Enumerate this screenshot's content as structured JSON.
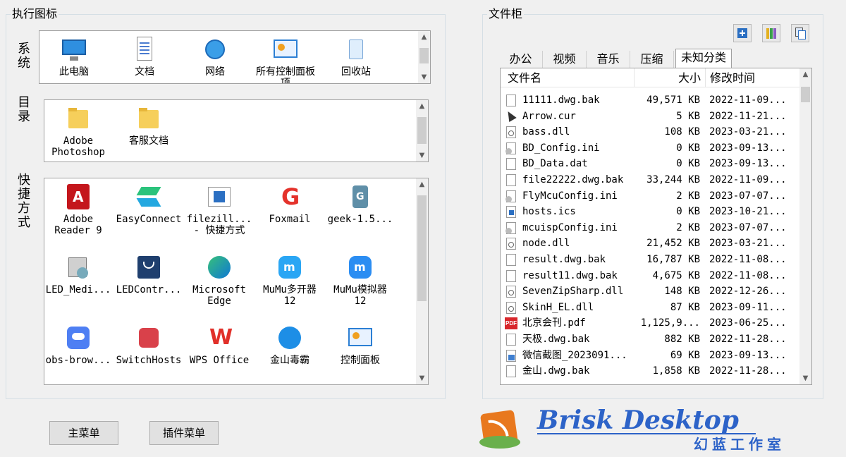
{
  "left_group": {
    "title": "执行图标"
  },
  "sections": {
    "system": {
      "label": "系统"
    },
    "directory": {
      "label": "目录"
    },
    "shortcut": {
      "label": "快捷方式"
    }
  },
  "system_items": [
    {
      "label": "此电脑",
      "icon": "computer-icon"
    },
    {
      "label": "文档",
      "icon": "document-icon"
    },
    {
      "label": "网络",
      "icon": "network-icon"
    },
    {
      "label": "所有控制面板项",
      "icon": "control-panel-icon"
    },
    {
      "label": "回收站",
      "icon": "recycle-bin-icon"
    }
  ],
  "directory_items": [
    {
      "label": "Adobe\nPhotoshop",
      "icon": "folder-icon"
    },
    {
      "label": "客服文档",
      "icon": "folder-icon"
    }
  ],
  "shortcut_items": [
    {
      "label": "Adobe\nReader 9",
      "icon": "adobe-reader-icon"
    },
    {
      "label": "EasyConnect",
      "icon": "easyconnect-icon"
    },
    {
      "label": "filezill...\n- 快捷方式",
      "icon": "filezilla-icon"
    },
    {
      "label": "Foxmail",
      "icon": "foxmail-icon"
    },
    {
      "label": "geek-1.5...",
      "icon": "geek-icon"
    },
    {
      "label": "LED_Medi...",
      "icon": "installer-icon"
    },
    {
      "label": "LEDContr...",
      "icon": "led-control-icon"
    },
    {
      "label": "Microsoft\nEdge",
      "icon": "edge-icon"
    },
    {
      "label": "MuMu多开器\n12",
      "icon": "mumu-multi-icon"
    },
    {
      "label": "MuMu模拟器\n12",
      "icon": "mumu-emulator-icon"
    },
    {
      "label": "obs-brow...",
      "icon": "obs-browser-icon"
    },
    {
      "label": "SwitchHosts",
      "icon": "switchhosts-icon"
    },
    {
      "label": "WPS Office",
      "icon": "wps-icon"
    },
    {
      "label": "金山毒霸",
      "icon": "kingsoft-icon"
    },
    {
      "label": "控制面板",
      "icon": "control-panel-icon"
    }
  ],
  "buttons": {
    "main_menu": "主菜单",
    "plugin_menu": "插件菜单"
  },
  "right_group": {
    "title": "文件柜"
  },
  "toolbar": [
    "add-icon",
    "columns-icon",
    "copy-icon"
  ],
  "tabs": [
    "办公",
    "视频",
    "音乐",
    "压缩",
    "未知分类"
  ],
  "active_tab": 4,
  "file_list": {
    "columns": {
      "name": "文件名",
      "size": "大小",
      "modified": "修改时间"
    },
    "rows": [
      {
        "name": "11111.dwg.bak",
        "size": "49,571 KB",
        "modified": "2022-11-09...",
        "icon": "file-icon"
      },
      {
        "name": "Arrow.cur",
        "size": "5 KB",
        "modified": "2022-11-21...",
        "icon": "cursor-icon"
      },
      {
        "name": "bass.dll",
        "size": "108 KB",
        "modified": "2023-03-21...",
        "icon": "dll-icon"
      },
      {
        "name": "BD_Config.ini",
        "size": "0 KB",
        "modified": "2023-09-13...",
        "icon": "ini-icon"
      },
      {
        "name": "BD_Data.dat",
        "size": "0 KB",
        "modified": "2023-09-13...",
        "icon": "file-icon"
      },
      {
        "name": "file22222.dwg.bak",
        "size": "33,244 KB",
        "modified": "2022-11-09...",
        "icon": "file-icon"
      },
      {
        "name": "FlyMcuConfig.ini",
        "size": "2 KB",
        "modified": "2023-07-07...",
        "icon": "ini-icon"
      },
      {
        "name": "hosts.ics",
        "size": "0 KB",
        "modified": "2023-10-21...",
        "icon": "ics-icon"
      },
      {
        "name": "mcuispConfig.ini",
        "size": "2 KB",
        "modified": "2023-07-07...",
        "icon": "ini-icon"
      },
      {
        "name": "node.dll",
        "size": "21,452 KB",
        "modified": "2023-03-21...",
        "icon": "dll-icon"
      },
      {
        "name": "result.dwg.bak",
        "size": "16,787 KB",
        "modified": "2022-11-08...",
        "icon": "file-icon"
      },
      {
        "name": "result11.dwg.bak",
        "size": "4,675 KB",
        "modified": "2022-11-08...",
        "icon": "file-icon"
      },
      {
        "name": "SevenZipSharp.dll",
        "size": "148 KB",
        "modified": "2022-12-26...",
        "icon": "dll-icon"
      },
      {
        "name": "SkinH_EL.dll",
        "size": "87 KB",
        "modified": "2023-09-11...",
        "icon": "dll-icon"
      },
      {
        "name": "北京会刊.pdf",
        "size": "1,125,9...",
        "modified": "2023-06-25...",
        "icon": "pdf-icon"
      },
      {
        "name": "天极.dwg.bak",
        "size": "882 KB",
        "modified": "2022-11-28...",
        "icon": "file-icon"
      },
      {
        "name": "微信截图_2023091...",
        "size": "69 KB",
        "modified": "2023-09-13...",
        "icon": "image-icon"
      },
      {
        "name": "金山.dwg.bak",
        "size": "1,858 KB",
        "modified": "2022-11-28...",
        "icon": "file-icon"
      }
    ]
  },
  "brand": {
    "name": "Brisk Desktop",
    "studio": "幻蓝工作室"
  }
}
